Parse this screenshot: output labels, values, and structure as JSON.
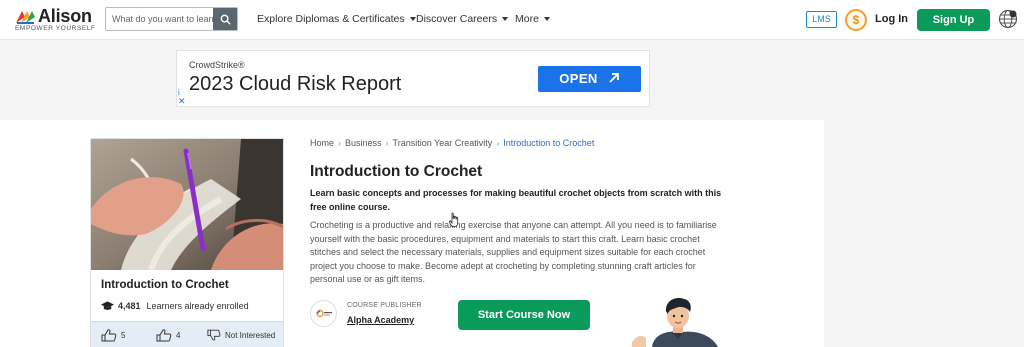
{
  "header": {
    "brand_name": "Alison",
    "brand_tagline": "EMPOWER YOURSELF",
    "search_placeholder": "What do you want to learn?",
    "nav": [
      {
        "label": "Explore Diplomas & Certificates"
      },
      {
        "label": "Discover Careers"
      },
      {
        "label": "More"
      }
    ],
    "lms_label": "LMS",
    "coin_symbol": "$",
    "login_label": "Log In",
    "signup_label": "Sign Up"
  },
  "ad": {
    "brand": "CrowdStrike®",
    "title": "2023 Cloud Risk Report",
    "cta": "OPEN",
    "info_icon": "i",
    "close_icon": "✕"
  },
  "course_card": {
    "title": "Introduction to Crochet",
    "enrolled_count": "4,481",
    "enrolled_label": "Learners already enrolled",
    "likes": "5",
    "likes2": "4",
    "not_interested": "Not Interested"
  },
  "breadcrumb": [
    "Home",
    "Business",
    "Transition Year Creativity",
    "Introduction to Crochet"
  ],
  "course": {
    "title": "Introduction to Crochet",
    "subtitle": "Learn basic concepts and processes for making beautiful crochet objects from scratch with this free online course.",
    "description": "Crocheting is a productive and relaxing exercise that anyone can attempt. All you need is to familiarise yourself with the basic procedures, equipment and materials to start this craft. Learn basic crochet stitches and select the necessary materials, supplies and equipment sizes suitable for each crochet project you choose to make. Become adept at crocheting by completing stunning craft articles for personal use or as gift items.",
    "publisher_label": "COURSE PUBLISHER",
    "publisher_name": "Alpha Academy",
    "start_label": "Start Course Now"
  },
  "colors": {
    "brand_green": "#0a9a5a",
    "link_blue": "#2f6eb6",
    "ad_blue": "#1a73e8",
    "coin_orange": "#f0a030"
  }
}
